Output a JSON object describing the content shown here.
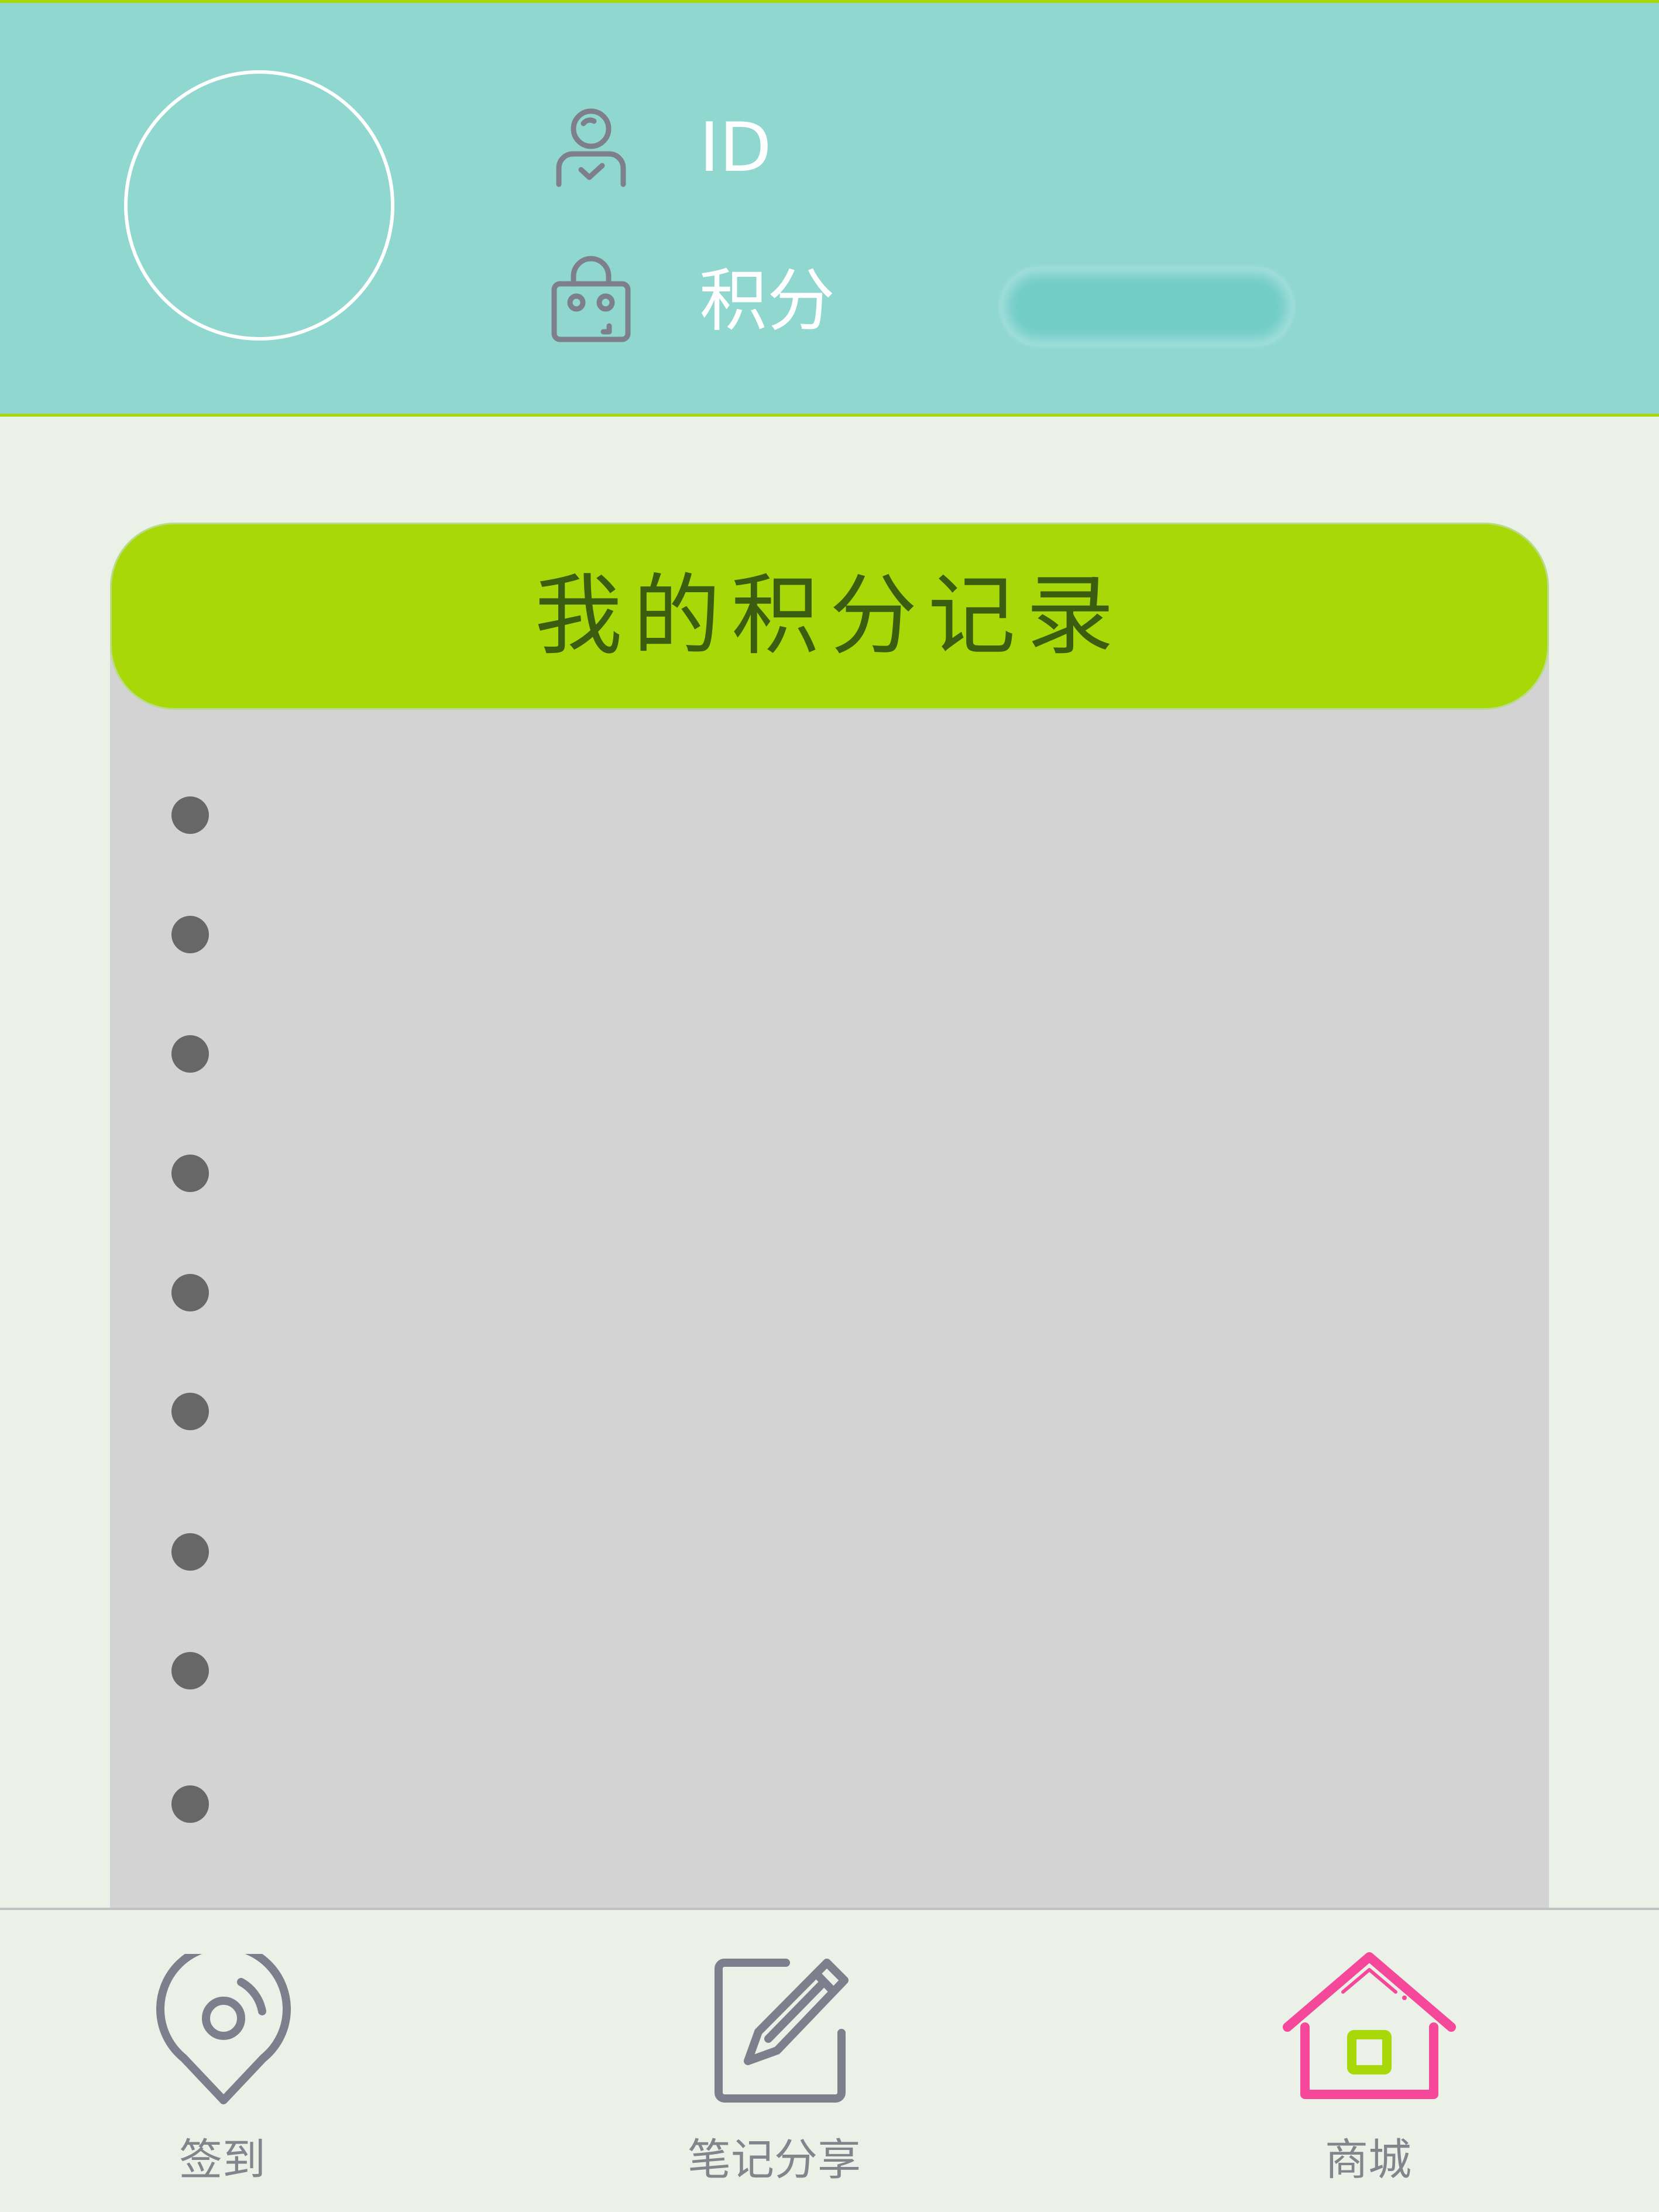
{
  "header": {
    "id_label": "ID",
    "points_label": "积分",
    "id_icon": "user-icon",
    "points_icon": "bag-icon"
  },
  "records": {
    "title": "我的积分记录",
    "items": [
      "",
      "",
      "",
      "",
      "",
      "",
      "",
      "",
      ""
    ]
  },
  "nav": {
    "items": [
      {
        "label": "签到",
        "icon": "location-pin-icon"
      },
      {
        "label": "笔记分享",
        "icon": "edit-note-icon"
      },
      {
        "label": "商城",
        "icon": "home-shop-icon",
        "active": true
      }
    ]
  },
  "colors": {
    "header_bg": "#90d8cf",
    "accent_green": "#a8d808",
    "active_pink": "#f5489a",
    "inactive_gray": "#84848c"
  }
}
